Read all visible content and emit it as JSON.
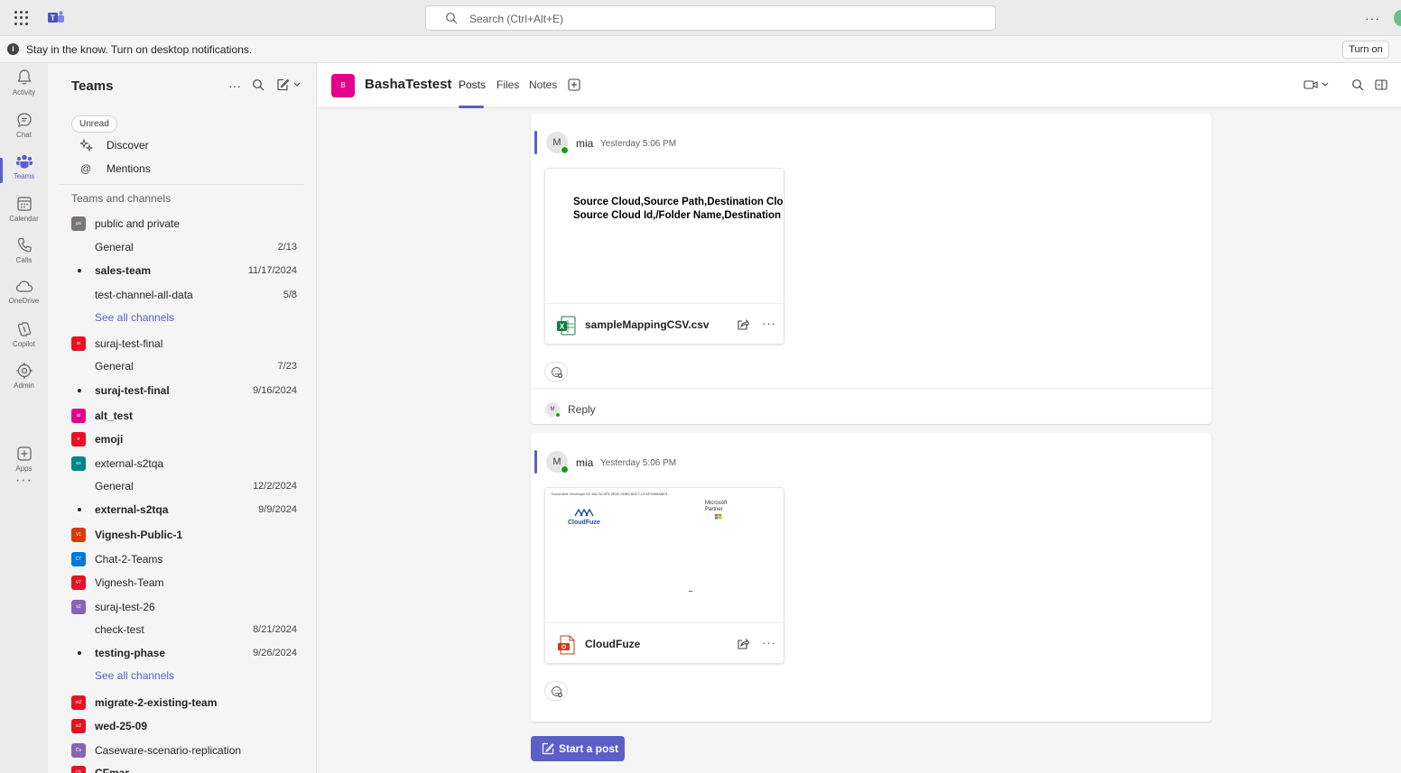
{
  "topbar": {
    "search_placeholder": "Search (Ctrl+Alt+E)",
    "more_label": "···"
  },
  "banner": {
    "text": "Stay in the know. Turn on desktop notifications.",
    "button": "Turn on"
  },
  "rail": {
    "items": [
      {
        "label": "Activity",
        "icon": "bell-icon"
      },
      {
        "label": "Chat",
        "icon": "chat-icon"
      },
      {
        "label": "Teams",
        "icon": "teams-icon"
      },
      {
        "label": "Calendar",
        "icon": "calendar-icon"
      },
      {
        "label": "Calls",
        "icon": "phone-icon"
      },
      {
        "label": "OneDrive",
        "icon": "cloud-icon"
      },
      {
        "label": "Copilot",
        "icon": "copilot-icon"
      },
      {
        "label": "Admin",
        "icon": "admin-icon"
      },
      {
        "label": "Apps",
        "icon": "apps-icon"
      }
    ],
    "more": "···",
    "active": "Teams"
  },
  "panel": {
    "title": "Teams",
    "more": "···",
    "filter_chip": "Unread",
    "nav": [
      {
        "label": "Discover",
        "icon": "discover-icon"
      },
      {
        "label": "Mentions",
        "icon": "at-icon"
      }
    ],
    "section_label": "Teams and channels",
    "tree": [
      {
        "kind": "team",
        "name": "public and private",
        "abbr": "pa",
        "color": "#7a7574",
        "bold": false
      },
      {
        "kind": "channel",
        "name": "General",
        "date": "2/13",
        "bold": false
      },
      {
        "kind": "channel",
        "name": "sales-team",
        "date": "11/17/2024",
        "bold": true
      },
      {
        "kind": "channel",
        "name": "test-channel-all-data",
        "date": "5/8",
        "bold": false
      },
      {
        "kind": "link",
        "name": "See all channels"
      },
      {
        "kind": "team",
        "name": "suraj-test-final",
        "abbr": "st",
        "color": "#e81123",
        "bold": false
      },
      {
        "kind": "channel",
        "name": "General",
        "date": "7/23",
        "bold": false
      },
      {
        "kind": "channel",
        "name": "suraj-test-final",
        "date": "9/16/2024",
        "bold": true
      },
      {
        "kind": "team",
        "name": "alt_test",
        "abbr": "at",
        "color": "#e3008c",
        "bold": true
      },
      {
        "kind": "team",
        "name": "emoji",
        "abbr": "e",
        "color": "#e81123",
        "bold": true
      },
      {
        "kind": "team",
        "name": "external-s2tqa",
        "abbr": "es",
        "color": "#038387",
        "bold": false
      },
      {
        "kind": "channel",
        "name": "General",
        "date": "12/2/2024",
        "bold": false
      },
      {
        "kind": "channel",
        "name": "external-s2tqa",
        "date": "9/9/2024",
        "bold": true
      },
      {
        "kind": "team",
        "name": "Vignesh-Public-1",
        "abbr": "V1",
        "color": "#da3b01",
        "bold": true
      },
      {
        "kind": "team",
        "name": "Chat-2-Teams",
        "abbr": "CT",
        "color": "#0078d4",
        "bold": false
      },
      {
        "kind": "team",
        "name": "Vignesh-Team",
        "abbr": "VT",
        "color": "#e81123",
        "bold": false
      },
      {
        "kind": "team",
        "name": "suraj-test-26",
        "abbr": "s2",
        "color": "#8764b8",
        "bold": false
      },
      {
        "kind": "channel",
        "name": "check-test",
        "date": "8/21/2024",
        "bold": false
      },
      {
        "kind": "channel",
        "name": "testing-phase",
        "date": "9/26/2024",
        "bold": true
      },
      {
        "kind": "link",
        "name": "See all channels"
      },
      {
        "kind": "team",
        "name": "migrate-2-existing-team",
        "abbr": "m2",
        "color": "#e81123",
        "bold": true
      },
      {
        "kind": "team",
        "name": "wed-25-09",
        "abbr": "w2",
        "color": "#e81123",
        "bold": true
      },
      {
        "kind": "team",
        "name": "Caseware-scenario-replication",
        "abbr": "Cs",
        "color": "#8764b8",
        "bold": false
      },
      {
        "kind": "team",
        "name": "CFmar",
        "abbr": "CF",
        "color": "#e81123",
        "bold": true
      }
    ]
  },
  "channel": {
    "avatar": "B",
    "name": "BashaTestest",
    "tabs": [
      "Posts",
      "Files",
      "Notes"
    ],
    "active_tab": "Posts"
  },
  "posts": [
    {
      "avatar": "M",
      "author": "mia",
      "time": "Yesterday 5:06 PM",
      "preview_lines": [
        "Source Cloud,Source Path,Destination Cloud",
        "Source Cloud Id,/Folder Name,Destination Cloud"
      ],
      "file_name": "sampleMappingCSV.csv",
      "file_type": "excel-icon",
      "reply_avatar": "M",
      "reply_label": "Reply"
    },
    {
      "avatar": "M",
      "author": "mia",
      "time": "Yesterday 5:06 PM",
      "pdf_top": "Document: Envelope ID: 8AC3C3F5-2E5F-4DB9-B0C7-CFAF5966A8E5",
      "pdf_logo": "CloudFuze",
      "pdf_partner_1": "Microsoft",
      "pdf_partner_2": "Partner",
      "file_name": "CloudFuze",
      "file_type": "pdf-icon"
    }
  ],
  "start_post": "Start a post"
}
